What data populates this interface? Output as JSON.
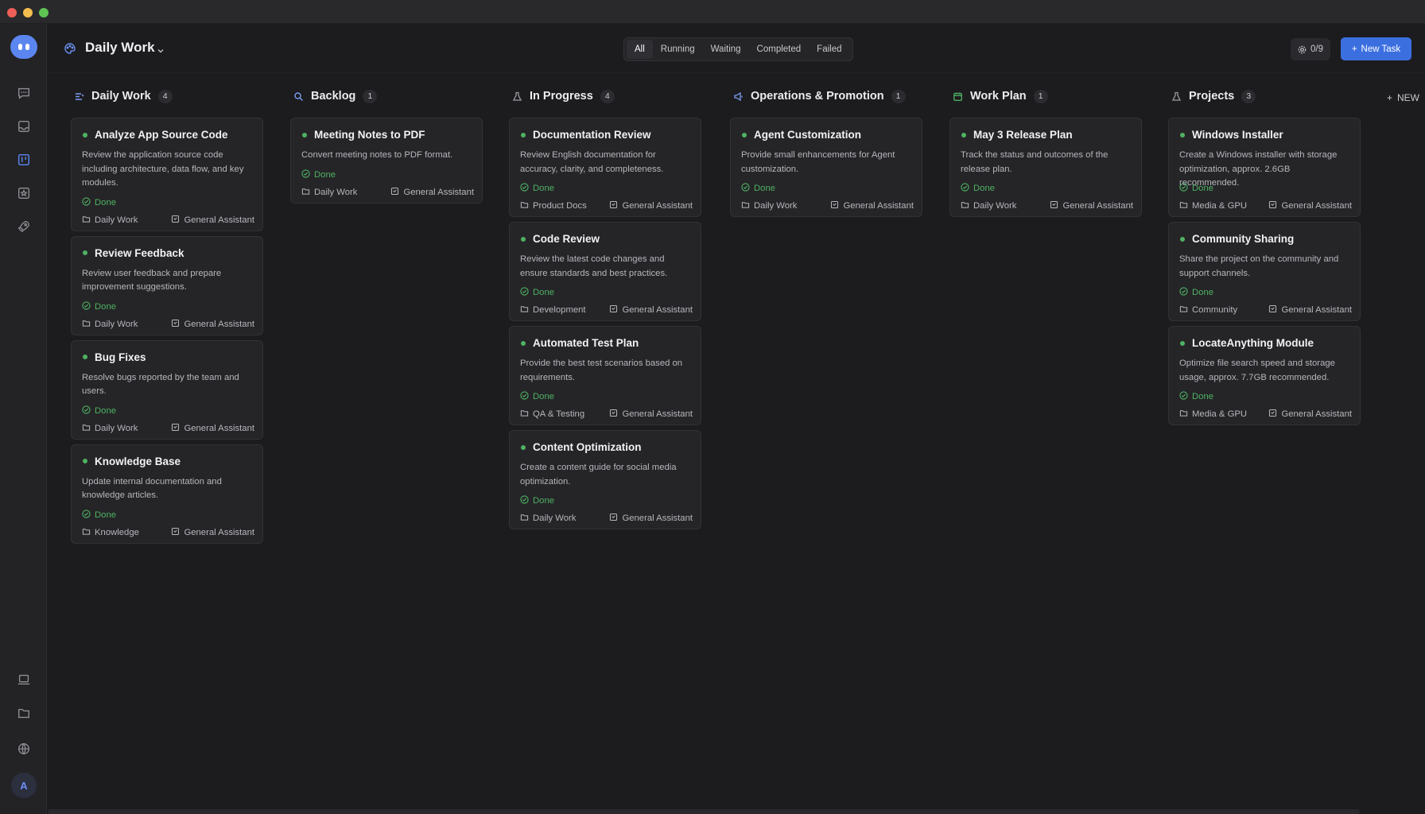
{
  "window": {
    "traffic_lights": [
      "close",
      "minimize",
      "zoom"
    ]
  },
  "sidebar": {
    "logo": "app-logo",
    "items": [
      {
        "icon": "chat-icon"
      },
      {
        "icon": "inbox-icon"
      },
      {
        "icon": "kanban-icon",
        "active": true
      },
      {
        "icon": "star-box-icon"
      },
      {
        "icon": "rocket-icon"
      }
    ],
    "bottom_items": [
      {
        "icon": "laptop-icon"
      },
      {
        "icon": "folder-icon"
      },
      {
        "icon": "globe-icon"
      }
    ],
    "avatar_label": "A"
  },
  "header": {
    "workspace_title": "Daily Work",
    "filters": [
      "All",
      "Running",
      "Waiting",
      "Completed",
      "Failed"
    ],
    "active_filter": "All",
    "counter": "0/9",
    "new_task_label": "New Task"
  },
  "add_column_label": "NEW",
  "colors": {
    "accent": "#3b6fe0",
    "done": "#4fb262",
    "background": "#1c1c1f",
    "card": "#252528"
  },
  "columns": [
    {
      "title": "Daily Work",
      "count": "4",
      "icon": "list-icon",
      "cards": [
        {
          "title": "Analyze App Source Code",
          "desc": "Review the application source code including architecture, data flow, and key modules.",
          "status": "Done",
          "folder": "Daily Work",
          "agent": "General Assistant"
        },
        {
          "title": "Review Feedback",
          "desc": "Review user feedback and prepare improvement suggestions.",
          "status": "Done",
          "folder": "Daily Work",
          "agent": "General Assistant"
        },
        {
          "title": "Bug Fixes",
          "desc": "Resolve bugs reported by the team and users.",
          "status": "Done",
          "folder": "Daily Work",
          "agent": "General Assistant"
        },
        {
          "title": "Knowledge Base",
          "desc": "Update internal documentation and knowledge articles.",
          "status": "Done",
          "folder": "Knowledge",
          "agent": "General Assistant"
        }
      ]
    },
    {
      "title": "Backlog",
      "count": "1",
      "icon": "search-icon",
      "cards": [
        {
          "title": "Meeting Notes to PDF",
          "desc": "Convert meeting notes to PDF format.",
          "status": "Done",
          "folder": "Daily Work",
          "agent": "General Assistant"
        }
      ]
    },
    {
      "title": "In Progress",
      "count": "4",
      "icon": "flask-icon",
      "cards": [
        {
          "title": "Documentation Review",
          "desc": "Review English documentation for accuracy, clarity, and completeness.",
          "status": "Done",
          "folder": "Product Docs",
          "agent": "General Assistant"
        },
        {
          "title": "Code Review",
          "desc": "Review the latest code changes and ensure standards and best practices.",
          "status": "Done",
          "folder": "Development",
          "agent": "General Assistant"
        },
        {
          "title": "Automated Test Plan",
          "desc": "Provide the best test scenarios based on requirements.",
          "status": "Done",
          "folder": "QA & Testing",
          "agent": "General Assistant"
        },
        {
          "title": "Content Optimization",
          "desc": "Create a content guide for social media optimization.",
          "status": "Done",
          "folder": "Daily Work",
          "agent": "General Assistant"
        }
      ]
    },
    {
      "title": "Operations & Promotion",
      "count": "1",
      "icon": "megaphone-icon",
      "cards": [
        {
          "title": "Agent Customization",
          "desc": "Provide small enhancements for Agent customization.",
          "status": "Done",
          "folder": "Daily Work",
          "agent": "General Assistant"
        }
      ]
    },
    {
      "title": "Work Plan",
      "count": "1",
      "icon": "calendar-icon",
      "cards": [
        {
          "title": "May 3 Release Plan",
          "desc": "Track the status and outcomes of the release plan.",
          "status": "Done",
          "folder": "Daily Work",
          "agent": "General Assistant"
        }
      ]
    },
    {
      "title": "Projects",
      "count": "3",
      "icon": "flask-icon",
      "cards": [
        {
          "title": "Windows Installer",
          "desc": "Create a Windows installer with storage optimization, approx. 2.6GB recommended.",
          "status": "Done",
          "folder": "Media & GPU",
          "agent": "General Assistant"
        },
        {
          "title": "Community Sharing",
          "desc": "Share the project on the community and support channels.",
          "status": "Done",
          "folder": "Community",
          "agent": "General Assistant"
        },
        {
          "title": "LocateAnything Module",
          "desc": "Optimize file search speed and storage usage, approx. 7.7GB recommended.",
          "status": "Done",
          "folder": "Media & GPU",
          "agent": "General Assistant"
        }
      ]
    }
  ]
}
